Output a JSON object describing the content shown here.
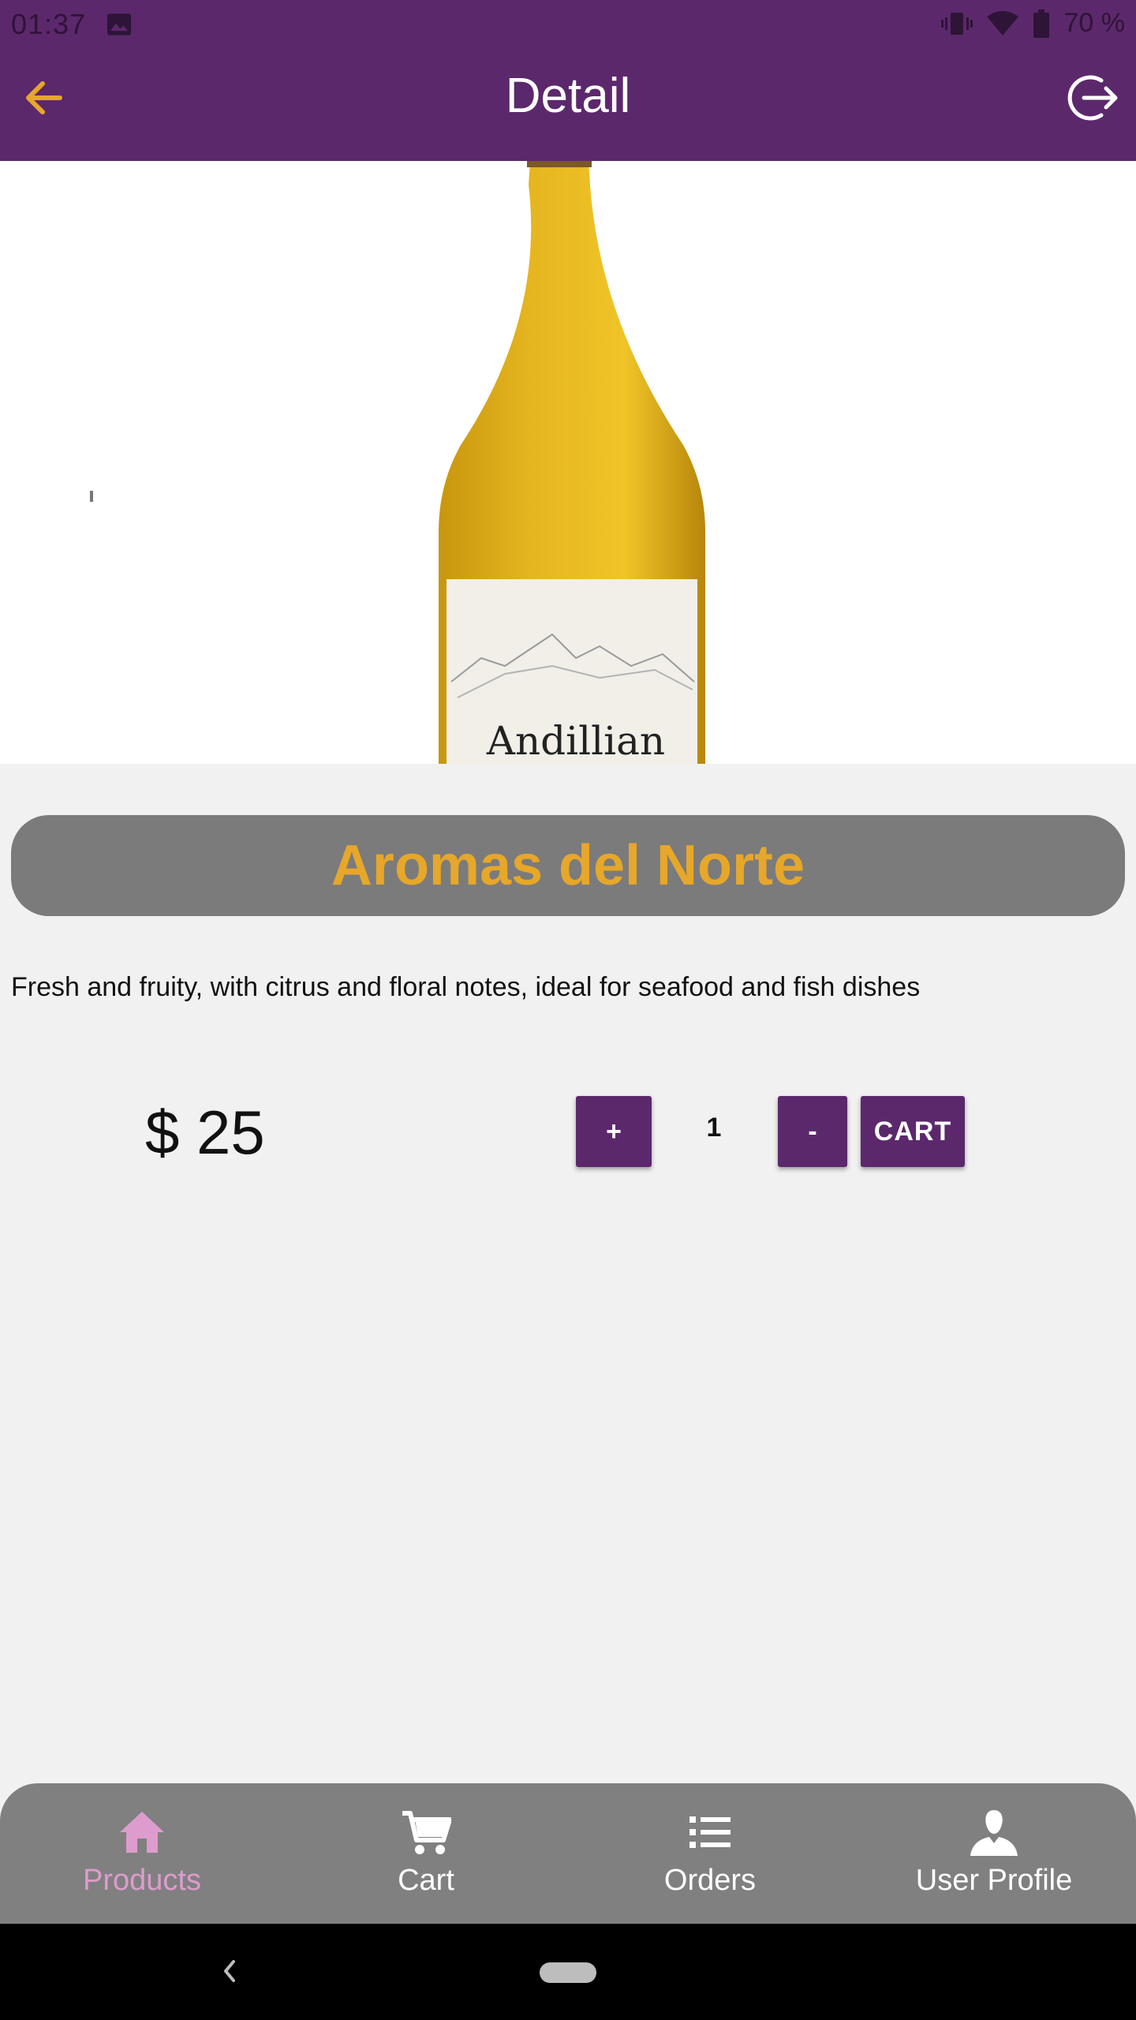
{
  "status_bar": {
    "time": "01:37",
    "battery": "70 %",
    "icons": [
      "image-icon",
      "vibrate-icon",
      "wifi-icon",
      "battery-icon"
    ]
  },
  "app_bar": {
    "title": "Detail",
    "back_icon": "arrow-left-icon",
    "logout_icon": "logout-icon",
    "accent_color": "#e6a72a",
    "background": "#5c286c"
  },
  "product": {
    "image_label": "Andillian",
    "name": "Aromas del Norte",
    "description": "Fresh and fruity, with citrus and floral notes, ideal for seafood and fish dishes",
    "price": "$ 25",
    "quantity": "1"
  },
  "actions": {
    "plus_label": "+",
    "minus_label": "-",
    "cart_label": "CART"
  },
  "bottom_nav": {
    "items": [
      {
        "label": "Products",
        "icon": "home-icon",
        "active": true
      },
      {
        "label": "Cart",
        "icon": "cart-icon",
        "active": false
      },
      {
        "label": "Orders",
        "icon": "list-icon",
        "active": false
      },
      {
        "label": "User Profile",
        "icon": "user-icon",
        "active": false
      }
    ],
    "active_color": "#dd9ccd"
  }
}
